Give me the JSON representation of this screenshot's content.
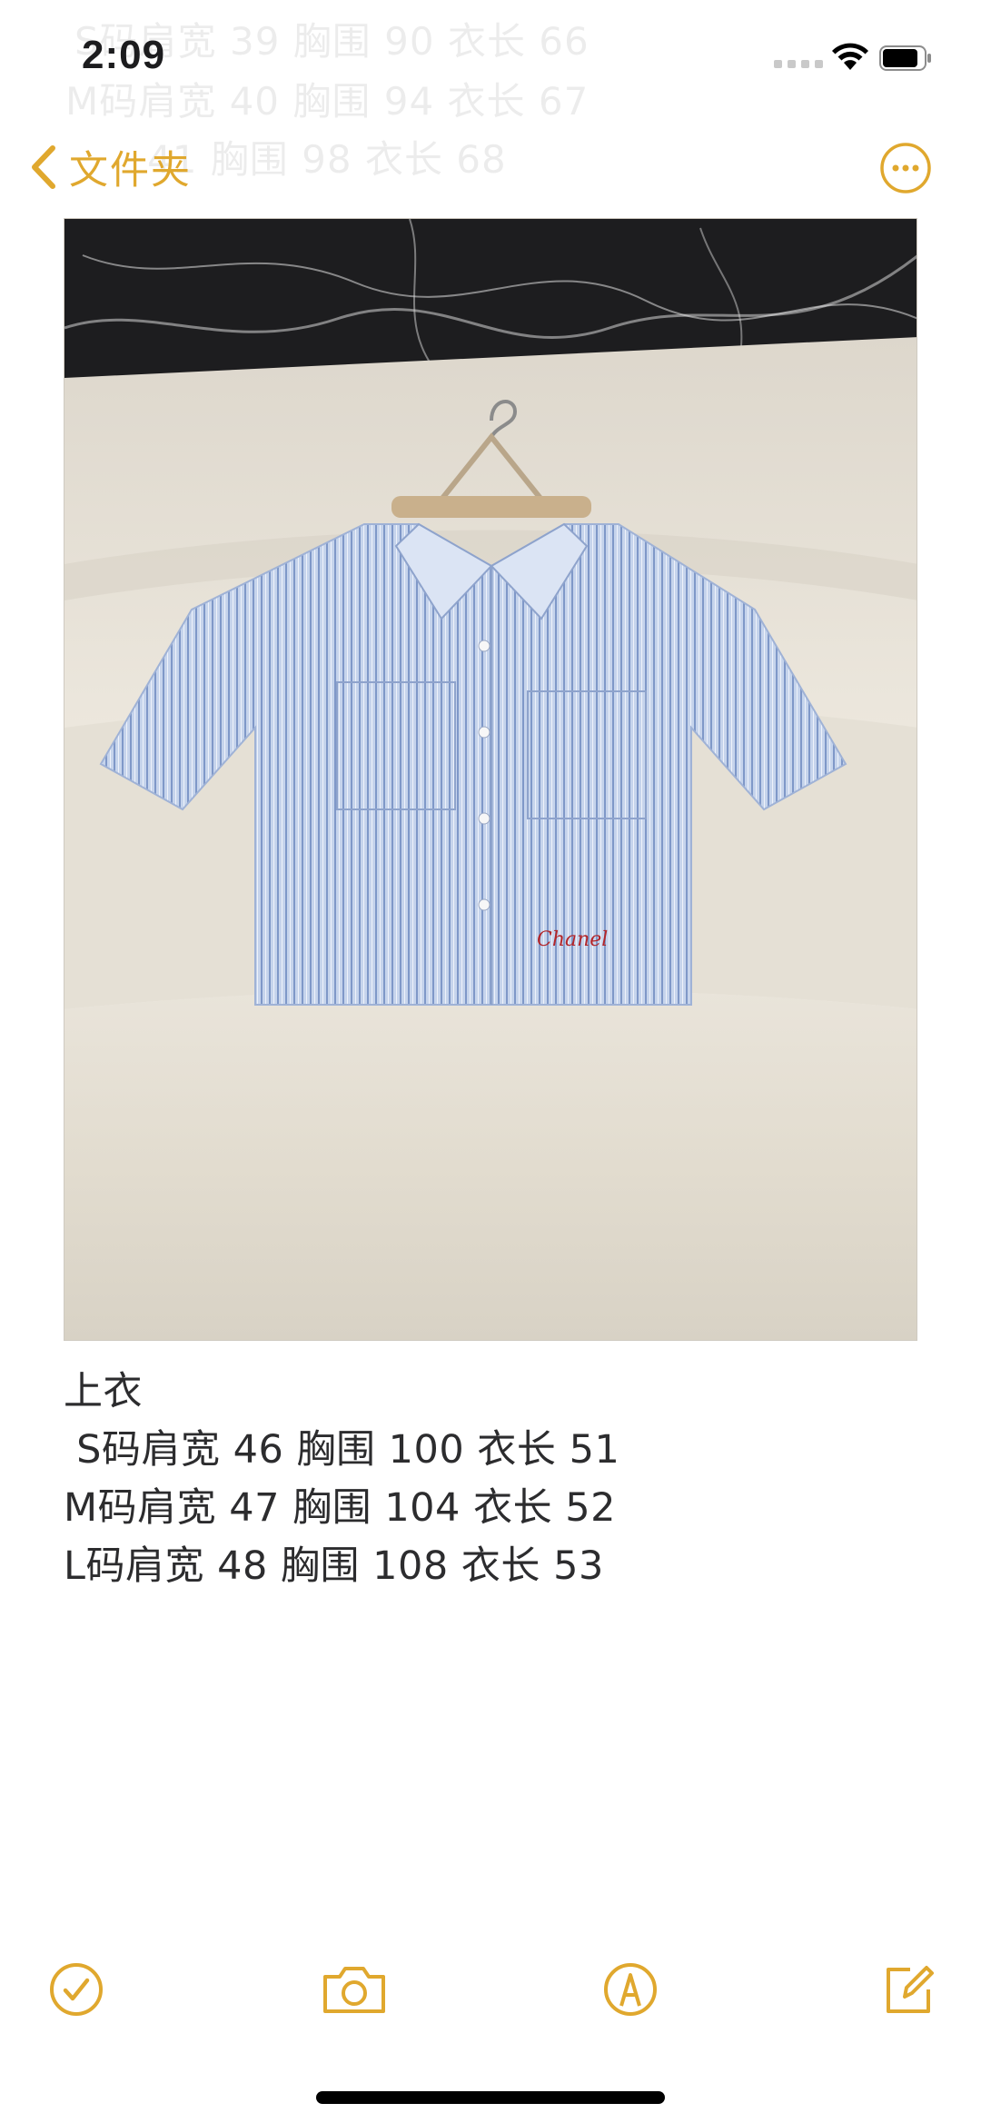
{
  "status_bar": {
    "time": "2:09"
  },
  "ghost_text": [
    "S码肩宽 39 胸围 90 衣长 66",
    "M码肩宽 40 胸围 94 衣长 67",
    "41 胸围 98 衣长 68"
  ],
  "nav": {
    "back_label": "文件夹",
    "more_icon": "ellipsis-circle-icon"
  },
  "note": {
    "image_description_icon": "shirt-photo",
    "lines": [
      "上衣",
      " S码肩宽 46 胸围 100 衣长 51",
      "M码肩宽 47 胸围 104 衣长 52",
      "L码肩宽 48 胸围 108 衣长 53"
    ],
    "embroidery_text": "Chanel"
  },
  "toolbar": {
    "items": [
      {
        "icon": "checklist-icon"
      },
      {
        "icon": "camera-icon"
      },
      {
        "icon": "markup-pen-icon"
      },
      {
        "icon": "compose-icon"
      }
    ]
  },
  "colors": {
    "accent": "#e0a82e",
    "text": "#2c2c2e"
  }
}
